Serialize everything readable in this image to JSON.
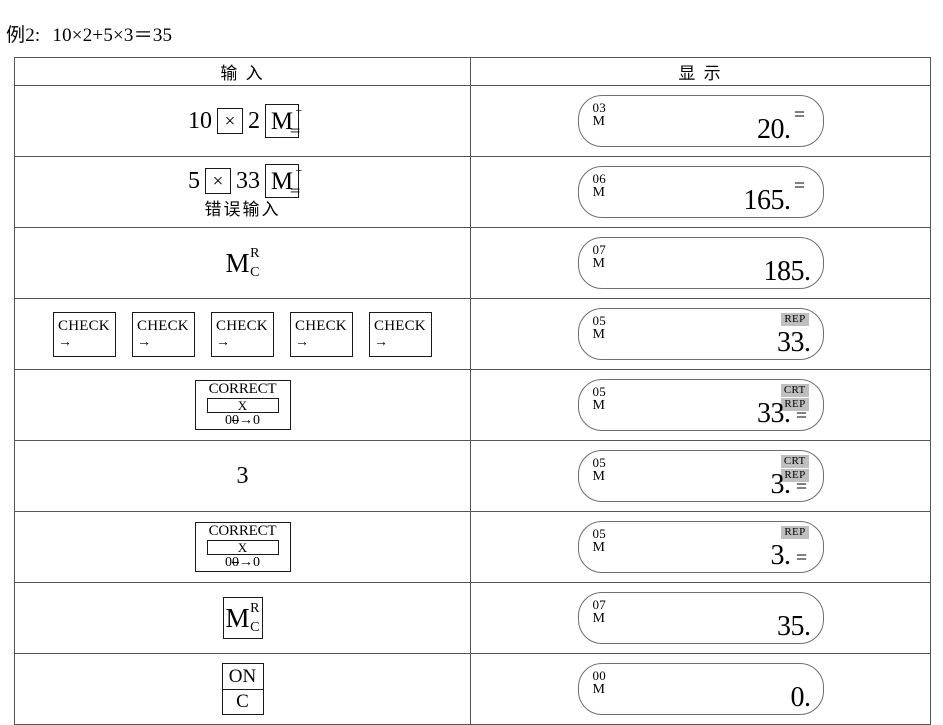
{
  "caption": {
    "label": "例2:",
    "expression": "10×2+5×3＝35"
  },
  "table": {
    "headers": {
      "input": "输 入",
      "display": "显 示"
    },
    "rows": [
      {
        "id": "row-1",
        "input": {
          "kind": "sequence",
          "tokens": [
            "10",
            "×",
            "2",
            "M"
          ],
          "num1": "10",
          "times": "×",
          "num2": "2",
          "m_letter": "M",
          "m_sup": "+",
          "m_sub": "＝"
        },
        "display": {
          "step": "03",
          "memory": "M",
          "number": "20.",
          "equals": "=",
          "badges": []
        }
      },
      {
        "id": "row-2",
        "input": {
          "kind": "sequence-with-note",
          "num1": "5",
          "times": "×",
          "num2": "33",
          "m_letter": "M",
          "m_sup": "+",
          "m_sub": "＝",
          "note": "错误输入"
        },
        "display": {
          "step": "06",
          "memory": "M",
          "number": "165.",
          "equals": "=",
          "badges": []
        }
      },
      {
        "id": "row-3",
        "input": {
          "kind": "mc-plain",
          "m_letter": "M",
          "m_sup": "R",
          "m_sub": "C"
        },
        "display": {
          "step": "07",
          "memory": "M",
          "number": "185.",
          "equals": "",
          "badges": []
        }
      },
      {
        "id": "row-4",
        "input": {
          "kind": "check-keys",
          "keys": [
            {
              "label": "CHECK",
              "arrow": "→"
            },
            {
              "label": "CHECK",
              "arrow": "→"
            },
            {
              "label": "CHECK",
              "arrow": "→"
            },
            {
              "label": "CHECK",
              "arrow": "→"
            },
            {
              "label": "CHECK",
              "arrow": "→"
            }
          ]
        },
        "display": {
          "step": "05",
          "memory": "M",
          "number": "33.",
          "equals": "",
          "badges": [
            "REP"
          ]
        }
      },
      {
        "id": "row-5",
        "input": {
          "kind": "correct-key",
          "label": "CORRECT",
          "mid": "X",
          "foot_a": "0",
          "foot_b": "0",
          "foot_arrow": "→",
          "foot_c": "0"
        },
        "display": {
          "step": "05",
          "memory": "M",
          "number": "33.",
          "equals": "=",
          "badges": [
            "CRT",
            "REP"
          ]
        }
      },
      {
        "id": "row-6",
        "input": {
          "kind": "plain-text",
          "text": "3"
        },
        "display": {
          "step": "05",
          "memory": "M",
          "number": "3.",
          "equals": "=",
          "badges": [
            "CRT",
            "REP"
          ]
        }
      },
      {
        "id": "row-7",
        "input": {
          "kind": "correct-key",
          "label": "CORRECT",
          "mid": "X",
          "foot_a": "0",
          "foot_b": "0",
          "foot_arrow": "→",
          "foot_c": "0"
        },
        "display": {
          "step": "05",
          "memory": "M",
          "number": "3.",
          "equals": "=",
          "badges": [
            "REP"
          ]
        }
      },
      {
        "id": "row-8",
        "input": {
          "kind": "mc-boxed",
          "m_letter": "M",
          "m_sup": "R",
          "m_sub": "C"
        },
        "display": {
          "step": "07",
          "memory": "M",
          "number": "35.",
          "equals": "",
          "badges": []
        }
      },
      {
        "id": "row-9",
        "input": {
          "kind": "on-c-key",
          "top": "ON",
          "bottom": "C"
        },
        "display": {
          "step": "00",
          "memory": "M",
          "number": "0.",
          "equals": "",
          "badges": []
        }
      }
    ]
  },
  "colors": {
    "badge_background": "#bfbfbf",
    "table_border": "#555555",
    "lcd_border": "#6e6e6e",
    "key_border": "#1a1a1a",
    "text": "#000000"
  }
}
